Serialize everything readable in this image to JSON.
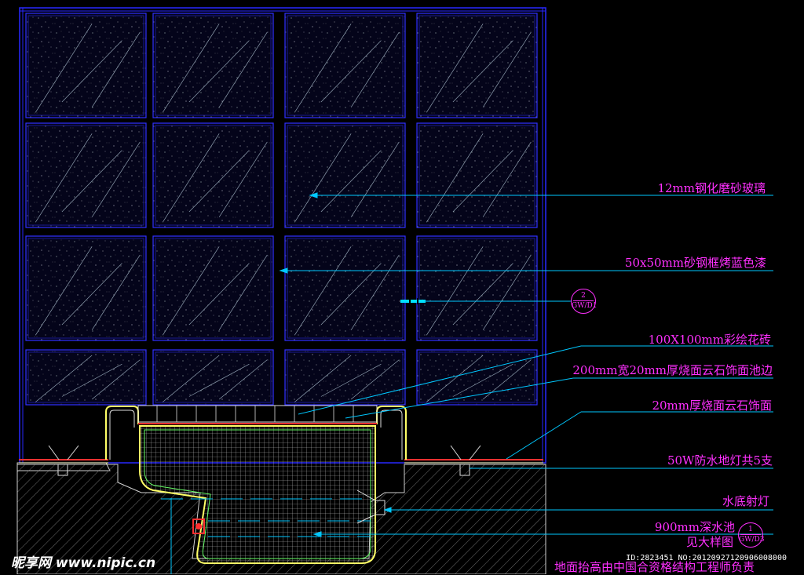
{
  "annotations": [
    {
      "id": "glass",
      "text": "12mm钢化磨砂玻璃"
    },
    {
      "id": "frame",
      "text": "50x50mm砂钢框烤蓝色漆"
    },
    {
      "id": "tile",
      "text": "100X100mm彩绘花砖"
    },
    {
      "id": "edge",
      "text": "200mm宽20mm厚烧面云石饰面池边"
    },
    {
      "id": "face",
      "text": "20mm厚烧面云石饰面"
    },
    {
      "id": "ground_light",
      "text": "50W防水地灯共5支"
    },
    {
      "id": "spot",
      "text": "水底射灯"
    },
    {
      "id": "pool",
      "text": "900mm深水池"
    },
    {
      "id": "see_detail",
      "text": "见大样图"
    },
    {
      "id": "note",
      "text": "地面抬高由中国合资格结构工程师负责"
    }
  ],
  "detail_refs": [
    {
      "id": "ref2",
      "top": "2",
      "bottom": "GW/D1"
    },
    {
      "id": "ref1",
      "top": "1",
      "bottom": "GW/D3"
    }
  ],
  "watermark": {
    "site": "昵享网 www.nipic.cn",
    "id_line": "ID:2823451 NO:20120927120906008000"
  },
  "colors": {
    "background": "#000000",
    "glass_frame": "#3030ff",
    "leader": "#00c8ff",
    "label": "#ff30ff",
    "pool_edge": "#ffff66",
    "tile_grid": "#cfcfcf"
  }
}
